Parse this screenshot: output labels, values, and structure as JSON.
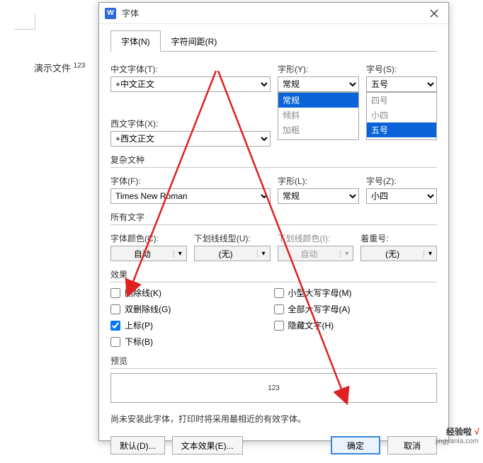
{
  "background": {
    "doc_text_prefix": "演示文件",
    "doc_text_sup": "123"
  },
  "dialog": {
    "title": "字体",
    "app_icon_letter": "W",
    "tabs": {
      "font": "字体(N)",
      "spacing": "字符间距(R)"
    },
    "cn_font_label": "中文字体(T):",
    "cn_font_value": "+中文正文",
    "west_font_label": "西文字体(X):",
    "west_font_value": "+西文正文",
    "style_label": "字形(Y):",
    "style_value": "常规",
    "style_options": {
      "regular": "常规",
      "italic": "倾斜",
      "bold": "加粗"
    },
    "size_label": "字号(S):",
    "size_value": "五号",
    "size_options": {
      "s4": "四号",
      "sx4": "小四",
      "s5": "五号"
    },
    "complex_title": "复杂文种",
    "cx_font_label": "字体(F):",
    "cx_font_value": "Times New Roman",
    "cx_style_label": "字形(L):",
    "cx_style_value": "常规",
    "cx_size_label": "字号(Z):",
    "cx_size_value": "小四",
    "all_text_title": "所有文字",
    "color_label": "字体颜色(C):",
    "color_value": "自动",
    "underline_label": "下划线线型(U):",
    "underline_value": "(无)",
    "ul_color_label": "下划线颜色(I):",
    "ul_color_value": "自动",
    "emphasis_label": "着重号:",
    "emphasis_value": "(无)",
    "effects_title": "效果",
    "eff": {
      "strike": "删除线(K)",
      "dstrike": "双删除线(G)",
      "super": "上标(P)",
      "sub": "下标(B)",
      "smallcaps": "小型大写字母(M)",
      "allcaps": "全部大写字母(A)",
      "hidden": "隐藏文字(H)"
    },
    "preview_title": "预览",
    "preview_text": "123",
    "hint_text": "尚未安装此字体，打印时将采用最相近的有效字体。",
    "buttons": {
      "default": "默认(D)...",
      "text_effect": "文本效果(E)...",
      "ok": "确定",
      "cancel": "取消"
    }
  },
  "watermark": {
    "line1": "经验啦",
    "line2": "jingyanla.com"
  }
}
